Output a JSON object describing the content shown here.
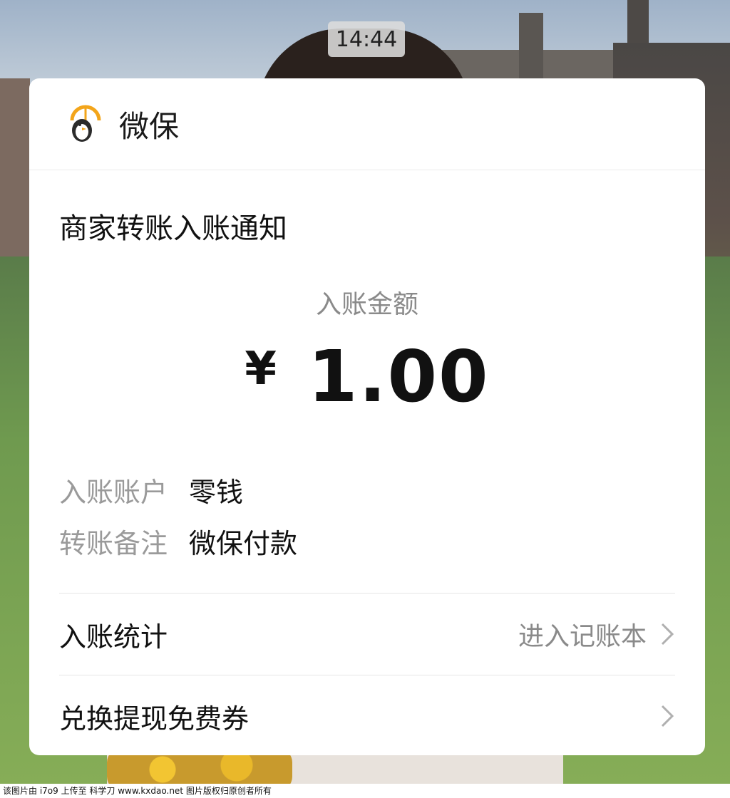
{
  "status": {
    "time": "14:44"
  },
  "card": {
    "app_name": "微保",
    "app_icon": "penguin-umbrella-icon",
    "notice_title": "商家转账入账通知",
    "amount_label": "入账金额",
    "currency_symbol": "¥",
    "amount": "1.00",
    "details": [
      {
        "label": "入账账户",
        "value": "零钱"
      },
      {
        "label": "转账备注",
        "value": "微保付款"
      }
    ],
    "links": [
      {
        "label": "入账统计",
        "action": "进入记账本"
      },
      {
        "label": "兑换提现免费券",
        "action": ""
      }
    ]
  },
  "footer_text": "该图片由 i7o9 上传至 科学刀 www.kxdao.net 图片版权归原创者所有",
  "colors": {
    "card_bg": "#ffffff",
    "muted_text": "#8a8a8a",
    "primary_text": "#111111",
    "accent_orange": "#f3a51a"
  }
}
